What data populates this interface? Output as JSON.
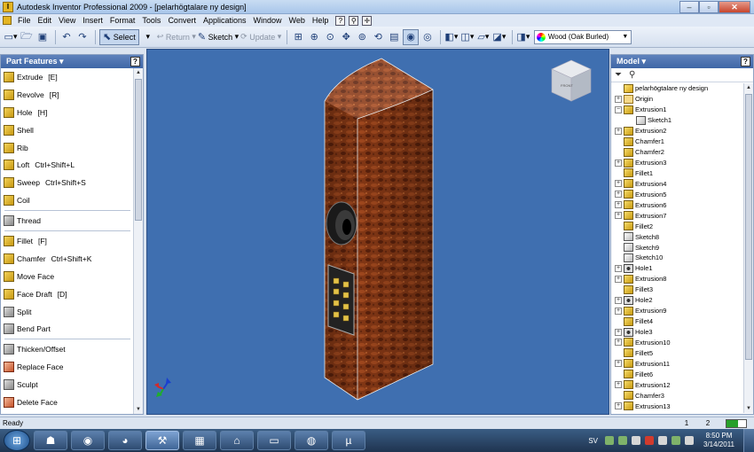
{
  "window": {
    "app_icon_letter": "I",
    "title": "Autodesk Inventor Professional 2009 - [pelarhögtalare ny design]",
    "min_label": "–",
    "max_label": "▫",
    "close_label": "✕"
  },
  "menu": [
    "File",
    "Edit",
    "View",
    "Insert",
    "Format",
    "Tools",
    "Convert",
    "Applications",
    "Window",
    "Web",
    "Help"
  ],
  "menu_extra_icons": [
    "?",
    "⚲",
    "✛"
  ],
  "toolbar": {
    "select_label": "Select",
    "return_label": "Return",
    "sketch_label": "Sketch",
    "update_label": "Update",
    "material_value": "Wood (Oak Burled)"
  },
  "left_panel": {
    "title": "Part Features ▾",
    "help": "?",
    "groups": [
      [
        {
          "name": "extrude",
          "label": "Extrude",
          "key": "[E]"
        },
        {
          "name": "revolve",
          "label": "Revolve",
          "key": "[R]"
        },
        {
          "name": "hole",
          "label": "Hole",
          "key": "[H]"
        },
        {
          "name": "shell",
          "label": "Shell",
          "key": ""
        },
        {
          "name": "rib",
          "label": "Rib",
          "key": ""
        },
        {
          "name": "loft",
          "label": "Loft",
          "key": "Ctrl+Shift+L"
        },
        {
          "name": "sweep",
          "label": "Sweep",
          "key": "Ctrl+Shift+S"
        },
        {
          "name": "coil",
          "label": "Coil",
          "key": ""
        }
      ],
      [
        {
          "name": "thread",
          "label": "Thread",
          "key": ""
        }
      ],
      [
        {
          "name": "fillet",
          "label": "Fillet",
          "key": "[F]"
        },
        {
          "name": "chamfer",
          "label": "Chamfer",
          "key": "Ctrl+Shift+K"
        },
        {
          "name": "move-face",
          "label": "Move Face",
          "key": ""
        },
        {
          "name": "face-draft",
          "label": "Face Draft",
          "key": "[D]"
        },
        {
          "name": "split",
          "label": "Split",
          "key": ""
        },
        {
          "name": "bend-part",
          "label": "Bend Part",
          "key": ""
        }
      ],
      [
        {
          "name": "thicken-offset",
          "label": "Thicken/Offset",
          "key": ""
        },
        {
          "name": "replace-face",
          "label": "Replace Face",
          "key": ""
        },
        {
          "name": "sculpt",
          "label": "Sculpt",
          "key": ""
        },
        {
          "name": "delete-face",
          "label": "Delete Face",
          "key": ""
        }
      ]
    ]
  },
  "viewcube_label": "FRONT",
  "right_panel": {
    "title": "Model ▾",
    "help": "?",
    "tree": [
      {
        "label": "pelarhögtalare ny design",
        "kind": "root",
        "exp": ""
      },
      {
        "label": "Origin",
        "kind": "folder",
        "exp": "+"
      },
      {
        "label": "Extrusion1",
        "kind": "feature",
        "exp": "−"
      },
      {
        "label": "Sketch1",
        "kind": "sketch",
        "exp": "",
        "child": true
      },
      {
        "label": "Extrusion2",
        "kind": "feature",
        "exp": "+"
      },
      {
        "label": "Chamfer1",
        "kind": "feature",
        "exp": ""
      },
      {
        "label": "Chamfer2",
        "kind": "feature",
        "exp": ""
      },
      {
        "label": "Extrusion3",
        "kind": "feature",
        "exp": "+"
      },
      {
        "label": "Fillet1",
        "kind": "feature",
        "exp": ""
      },
      {
        "label": "Extrusion4",
        "kind": "feature",
        "exp": "+"
      },
      {
        "label": "Extrusion5",
        "kind": "feature",
        "exp": "+"
      },
      {
        "label": "Extrusion6",
        "kind": "feature",
        "exp": "+"
      },
      {
        "label": "Extrusion7",
        "kind": "feature",
        "exp": "+"
      },
      {
        "label": "Fillet2",
        "kind": "feature",
        "exp": ""
      },
      {
        "label": "Sketch8",
        "kind": "sketch",
        "exp": ""
      },
      {
        "label": "Sketch9",
        "kind": "sketch",
        "exp": ""
      },
      {
        "label": "Sketch10",
        "kind": "sketch",
        "exp": ""
      },
      {
        "label": "Hole1",
        "kind": "hole",
        "exp": "+"
      },
      {
        "label": "Extrusion8",
        "kind": "feature",
        "exp": "+"
      },
      {
        "label": "Fillet3",
        "kind": "feature",
        "exp": ""
      },
      {
        "label": "Hole2",
        "kind": "hole",
        "exp": "+"
      },
      {
        "label": "Extrusion9",
        "kind": "feature",
        "exp": "+"
      },
      {
        "label": "Fillet4",
        "kind": "feature",
        "exp": ""
      },
      {
        "label": "Hole3",
        "kind": "hole",
        "exp": "+"
      },
      {
        "label": "Extrusion10",
        "kind": "feature",
        "exp": "+"
      },
      {
        "label": "Fillet5",
        "kind": "feature",
        "exp": ""
      },
      {
        "label": "Extrusion11",
        "kind": "feature",
        "exp": "+"
      },
      {
        "label": "Fillet6",
        "kind": "feature",
        "exp": ""
      },
      {
        "label": "Extrusion12",
        "kind": "feature",
        "exp": "+"
      },
      {
        "label": "Chamfer3",
        "kind": "feature",
        "exp": ""
      },
      {
        "label": "Extrusion13",
        "kind": "feature",
        "exp": "+"
      }
    ]
  },
  "status": {
    "ready": "Ready",
    "num1": "1",
    "num2": "2"
  },
  "taskbar": {
    "apps": [
      "chrome",
      "inventor",
      "calculator",
      "network",
      "explorer",
      "spotify",
      "utorrent"
    ],
    "lang": "SV",
    "time": "8:50 PM",
    "date": "3/14/2011"
  },
  "colors": {
    "viewport_bg": "#3f6fb0",
    "wood_dark": "#5e220c",
    "wood_light": "#a74b1f"
  }
}
